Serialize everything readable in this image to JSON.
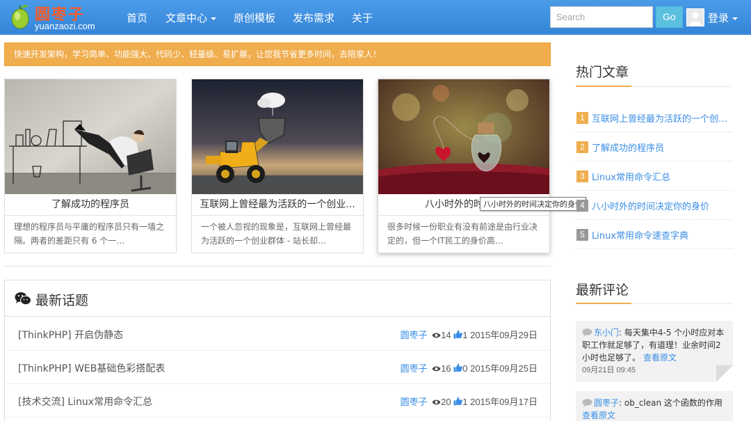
{
  "brand": {
    "name_cn": "圆枣子",
    "domain": "yuanzaozi.com"
  },
  "nav": {
    "items": [
      {
        "label": "首页",
        "dropdown": false
      },
      {
        "label": "文章中心",
        "dropdown": true
      },
      {
        "label": "原创模板",
        "dropdown": false
      },
      {
        "label": "发布需求",
        "dropdown": false
      },
      {
        "label": "关于",
        "dropdown": false
      }
    ],
    "search_placeholder": "Search",
    "go_label": "Go",
    "login_label": "登录"
  },
  "notice": "快速开发架构，学习简单、功能强大、代码少、轻量级、易扩展，让您我节省更多时间，去陪家人！",
  "cards": [
    {
      "title": "了解成功的程序员",
      "desc": "理想的程序员与平庸的程序员只有一墙之隔。两者的差距只有 6 个一…",
      "image": "man-feet-on-desk"
    },
    {
      "title": "互联网上曾经最为活跃的一个创业...",
      "desc": "一个被人忽视的现象是，互联网上曾经最为活跃的一个创业群体 - 站长却…",
      "image": "wheel-loader"
    },
    {
      "title": "八小时外的时间决",
      "desc": "很多时候一份职业有没有前途是由行业决定的，但一个IT民工的身价高…",
      "image": "heart-jar"
    }
  ],
  "tooltip": "八小时外的时间决定你的身价",
  "topics": {
    "title": "最新话题",
    "rows": [
      {
        "title": "[ThinkPHP] 开启伪静态",
        "author": "圆枣子",
        "views": "14",
        "likes": "1",
        "date": "2015年09月29日"
      },
      {
        "title": "[ThinkPHP] WEB基础色彩搭配表",
        "author": "圆枣子",
        "views": "16",
        "likes": "0",
        "date": "2015年09月25日"
      },
      {
        "title": "[技术交流] Linux常用命令汇总",
        "author": "圆枣子",
        "views": "20",
        "likes": "1",
        "date": "2015年09月17日"
      }
    ]
  },
  "hot": {
    "title": "热门文章",
    "items": [
      {
        "num": "1",
        "title": "互联网上曾经最为活跃的一个创业...",
        "color": "#f0ad4e"
      },
      {
        "num": "2",
        "title": "了解成功的程序员",
        "color": "#f0ad4e"
      },
      {
        "num": "3",
        "title": "Linux常用命令汇总",
        "color": "#f0ad4e"
      },
      {
        "num": "4",
        "title": "八小时外的时间决定你的身价",
        "color": "#999999"
      },
      {
        "num": "5",
        "title": "Linux常用命令速查字典",
        "color": "#999999"
      }
    ]
  },
  "comments": {
    "title": "最新评论",
    "items": [
      {
        "user": "东小门",
        "text": ": 每天集中4-5 个小时应对本职工作就足够了，有道理！业余时间2小时也足够了。",
        "link": "查看原文",
        "time": "09月21日 09:45"
      },
      {
        "user": "圆枣子",
        "text": ": ob_clean 这个函数的作用",
        "link": "查看原文",
        "time": ""
      }
    ]
  },
  "colors": {
    "nav": "#3a8ee6",
    "accent": "#f0ad4e",
    "link": "#3a8ee6",
    "go": "#5bc0de"
  }
}
